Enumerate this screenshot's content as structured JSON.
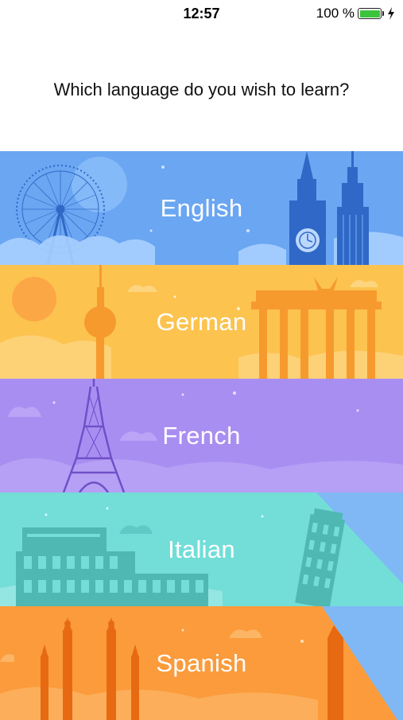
{
  "status": {
    "time": "12:57",
    "battery": "100 %"
  },
  "prompt": "Which language do you wish to learn?",
  "languages": [
    {
      "label": "English",
      "color": "#6aa6f2"
    },
    {
      "label": "German",
      "color": "#fcc34f"
    },
    {
      "label": "French",
      "color": "#a98ef2"
    },
    {
      "label": "Italian",
      "color": "#73ddd8"
    },
    {
      "label": "Spanish",
      "color": "#fb9b3b"
    }
  ],
  "colors": {
    "battery": "#3dc43d"
  }
}
